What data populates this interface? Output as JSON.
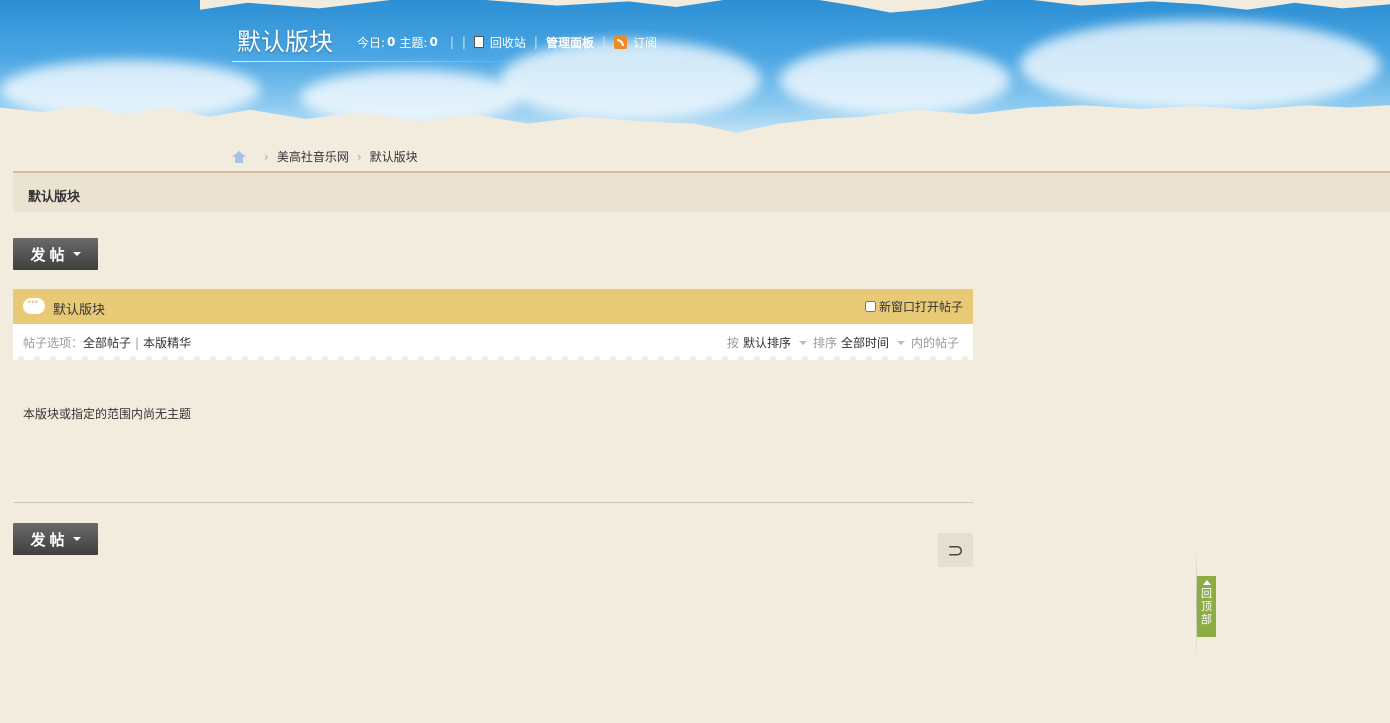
{
  "header": {
    "forum_title": "默认版块",
    "today_label": "今日:",
    "today_count": "0",
    "topics_label": "主题:",
    "topics_count": "0",
    "recycle_label": "回收站",
    "admin_label": "管理面板",
    "rss_label": "订阅"
  },
  "breadcrumb": {
    "site": "美高社音乐网",
    "current": "默认版块"
  },
  "namebar": {
    "title": "默认版块"
  },
  "post_button": {
    "label": "发帖"
  },
  "thread_list": {
    "title": "默认版块",
    "new_window_label": "新窗口打开帖子",
    "filter_prefix": "帖子选项：",
    "filter_all": "全部帖子",
    "filter_digest": "本版精华",
    "sort_by": "按",
    "sort_value": "默认排序",
    "sort_label": "排序",
    "time_value": "全部时间",
    "time_suffix": "内的帖子",
    "empty_message": "本版块或指定的范围内尚无主题"
  },
  "back_to_top": {
    "label": "回顶部"
  },
  "colors": {
    "page_bg": "#f2ecdf",
    "list_header": "#e8c976",
    "back_to_top": "#8bad42",
    "post_button": "#4a4a4a"
  }
}
